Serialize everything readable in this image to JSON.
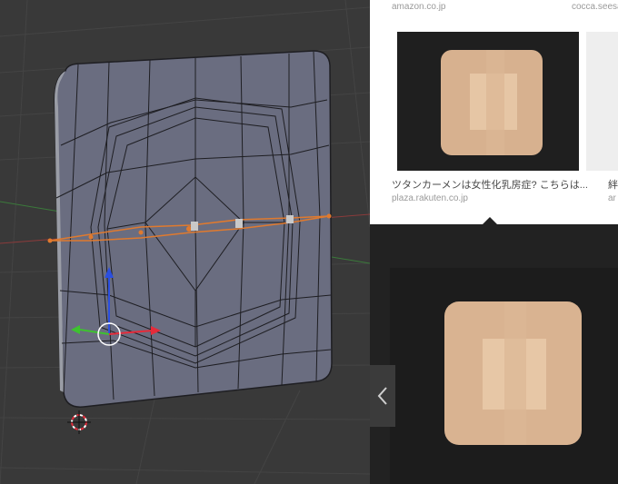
{
  "viewport": {
    "description_icons": [
      "3d-cursor-icon",
      "transform-gizmo-icon"
    ],
    "colors": {
      "background": "#393939",
      "mesh_face": "#6a6d80",
      "selection": "#e07a2e",
      "axis_x": "#e62b3a",
      "axis_y": "#3ec230",
      "axis_z": "#2b4fe0"
    }
  },
  "search": {
    "results": [
      {
        "domain": "amazon.co.jp",
        "caption": ""
      },
      {
        "domain": "cocca.seesa",
        "caption": ""
      },
      {
        "domain": "plaza.rakuten.co.jp",
        "caption": "ツタンカーメンは女性化乳房症? こちらは..."
      },
      {
        "domain": "ar",
        "caption": "絆"
      }
    ],
    "prev_button_icon": "chevron-left-icon"
  }
}
